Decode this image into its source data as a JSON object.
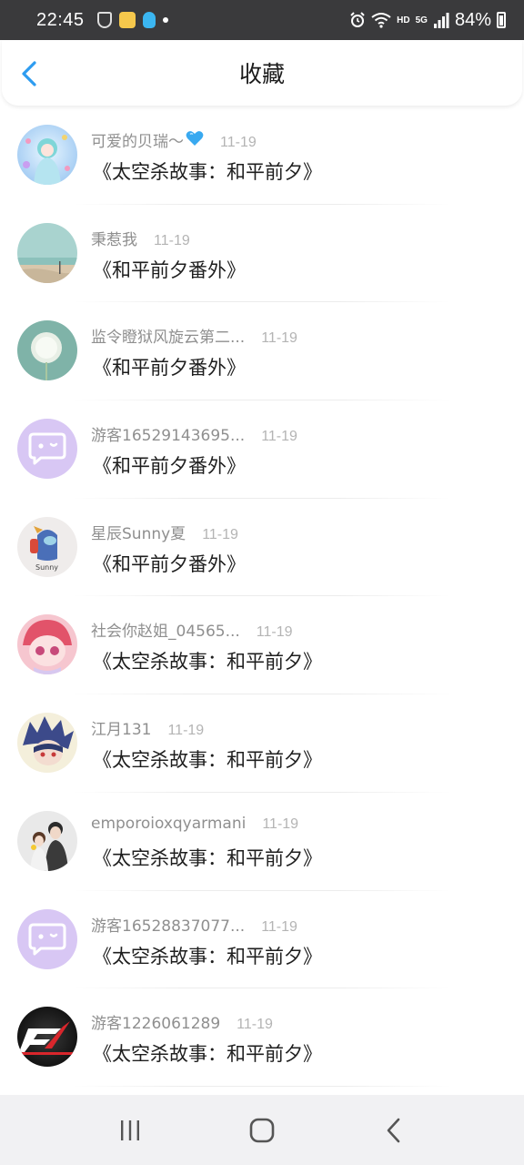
{
  "status_bar": {
    "time": "22:45",
    "hd": "HD",
    "net": "5G",
    "battery": "84%",
    "icons": [
      "shield-icon",
      "app-icon",
      "qq-icon",
      "dot-icon",
      "alarm-icon",
      "wifi-icon",
      "signal-icon",
      "battery-icon"
    ]
  },
  "header": {
    "title": "收藏",
    "back_icon": "chevron-left-icon"
  },
  "items": [
    {
      "user": "可爱的贝瑞～",
      "date": "11-19",
      "title": "《太空杀故事：和平前夕》",
      "avatar": "anime-girl-avatar",
      "badge": "blue-heart-icon"
    },
    {
      "user": "秉惹我",
      "date": "11-19",
      "title": "《和平前夕番外》",
      "avatar": "beach-avatar"
    },
    {
      "user": "监令瞪狱风旋云第二...",
      "date": "11-19",
      "title": "《和平前夕番外》",
      "avatar": "dandelion-avatar"
    },
    {
      "user": "游客16529143695...",
      "date": "11-19",
      "title": "《和平前夕番外》",
      "avatar": "guest-chat-avatar"
    },
    {
      "user": "星辰Sunny夏",
      "date": "11-19",
      "title": "《和平前夕番外》",
      "avatar": "crewmate-avatar"
    },
    {
      "user": "社会你赵姐_04565...",
      "date": "11-19",
      "title": "《太空杀故事：和平前夕》",
      "avatar": "pink-anime-avatar"
    },
    {
      "user": "江月131",
      "date": "11-19",
      "title": "《太空杀故事：和平前夕》",
      "avatar": "blue-hair-avatar"
    },
    {
      "user": "emporoioxqyarmani",
      "date": "11-19",
      "title": "《太空杀故事：和平前夕》",
      "avatar": "couple-avatar"
    },
    {
      "user": "游客16528837077...",
      "date": "11-19",
      "title": "《太空杀故事：和平前夕》",
      "avatar": "guest-chat-avatar"
    },
    {
      "user": "游客1226061289",
      "date": "11-19",
      "title": "《太空杀故事：和平前夕》",
      "avatar": "nfs-logo-avatar"
    }
  ],
  "nav_bar": {
    "icons": [
      "recent-apps-icon",
      "home-icon",
      "back-icon"
    ]
  },
  "colors": {
    "accent": "#2d9cf0",
    "guest_avatar": "#d8c7f4",
    "status_bar": "#3a3a3c"
  }
}
